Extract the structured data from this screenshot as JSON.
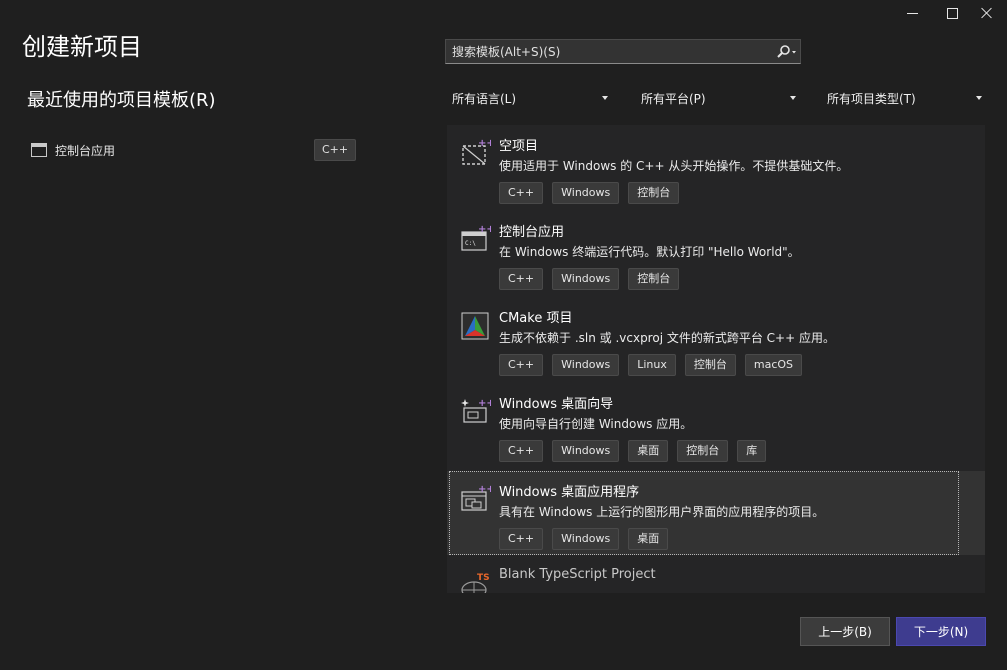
{
  "title": "创建新项目",
  "recent": {
    "heading": "最近使用的项目模板(R)",
    "items": [
      {
        "label": "控制台应用",
        "tag": "C++"
      }
    ]
  },
  "search": {
    "placeholder": "搜索模板(Alt+S)(S)"
  },
  "filters": {
    "language": "所有语言(L)",
    "platform": "所有平台(P)",
    "type": "所有项目类型(T)"
  },
  "templates": [
    {
      "title": "空项目",
      "desc": "使用适用于 Windows 的 C++ 从头开始操作。不提供基础文件。",
      "tags": [
        "C++",
        "Windows",
        "控制台"
      ],
      "icon": "empty-project-icon"
    },
    {
      "title": "控制台应用",
      "desc": "在 Windows 终端运行代码。默认打印 \"Hello World\"。",
      "tags": [
        "C++",
        "Windows",
        "控制台"
      ],
      "icon": "console-app-icon"
    },
    {
      "title": "CMake 项目",
      "desc": "生成不依赖于 .sln 或 .vcxproj 文件的新式跨平台 C++ 应用。",
      "tags": [
        "C++",
        "Windows",
        "Linux",
        "控制台",
        "macOS"
      ],
      "icon": "cmake-icon"
    },
    {
      "title": "Windows 桌面向导",
      "desc": "使用向导自行创建 Windows 应用。",
      "tags": [
        "C++",
        "Windows",
        "桌面",
        "控制台",
        "库"
      ],
      "icon": "desktop-wizard-icon"
    },
    {
      "title": "Windows 桌面应用程序",
      "desc": "具有在 Windows 上运行的图形用户界面的应用程序的项目。",
      "tags": [
        "C++",
        "Windows",
        "桌面"
      ],
      "icon": "desktop-app-icon"
    },
    {
      "title": "Blank TypeScript Project",
      "desc": "",
      "tags": [],
      "icon": "typescript-project-icon"
    }
  ],
  "buttons": {
    "back": "上一步(B)",
    "next": "下一步(N)"
  },
  "colors": {
    "background": "#1f1f1f",
    "list_background": "#252526",
    "accent": "#3e3c8f",
    "tag_background": "#3a3a3a"
  }
}
